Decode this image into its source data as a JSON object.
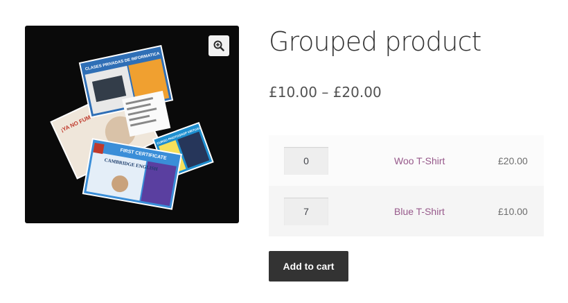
{
  "product": {
    "title": "Grouped product",
    "price_range": "£10.00 – £20.00",
    "items": [
      {
        "qty": "0",
        "name": "Woo T-Shirt",
        "price": "£20.00"
      },
      {
        "qty": "7",
        "name": "Blue T-Shirt",
        "price": "£10.00"
      }
    ],
    "add_to_cart_label": "Add to cart"
  },
  "gallery": {
    "zoom_icon": "magnifier-plus-icon",
    "flyers": {
      "informatica": "CLASES PRIVADAS DE INFORMATICA",
      "fumo": "¡YA NO FUMO, GRACIAS!",
      "photoshop": "CURSO PHOTOSHOP VIRTUAL",
      "certificate": "FIRST CERTIFICATE",
      "cambridge": "CAMBRIDGE ENGLISH"
    }
  },
  "colors": {
    "link": "#96588a",
    "button_bg": "#333333",
    "gallery_bg": "#0a0a0a"
  }
}
